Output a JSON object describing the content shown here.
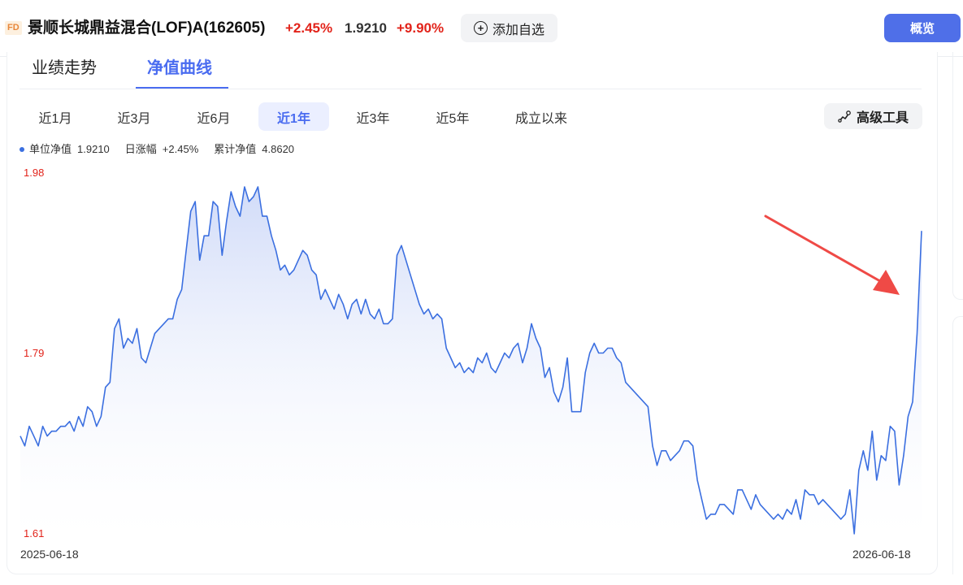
{
  "header": {
    "badge": "FD",
    "fund_name": "景顺长城鼎益混合(LOF)A(162605)",
    "change": "+2.45%",
    "nav": "1.9210",
    "pct": "+9.90%",
    "add_label": "添加自选",
    "overview_label": "概览"
  },
  "tabs": [
    {
      "label": "业绩走势",
      "active": false
    },
    {
      "label": "净值曲线",
      "active": true
    }
  ],
  "ranges": [
    {
      "label": "近1月",
      "active": false
    },
    {
      "label": "近3月",
      "active": false
    },
    {
      "label": "近6月",
      "active": false
    },
    {
      "label": "近1年",
      "active": true
    },
    {
      "label": "近3年",
      "active": false
    },
    {
      "label": "近5年",
      "active": false
    },
    {
      "label": "成立以来",
      "active": false
    }
  ],
  "tools_label": "高级工具",
  "legend": {
    "unit_nav_label": "单位净值",
    "unit_nav_value": "1.9210",
    "daily_label": "日涨幅",
    "daily_value": "+2.45%",
    "cum_label": "累计净值",
    "cum_value": "4.8620"
  },
  "colors": {
    "line": "#3b6fe0",
    "accent": "#4a6cf0",
    "up": "#e2231a",
    "arrow": "#ef4a46"
  },
  "chart_data": {
    "type": "area",
    "series": [
      {
        "values": [
          1.71,
          1.7,
          1.72,
          1.71,
          1.7,
          1.72,
          1.71,
          1.715,
          1.715,
          1.72,
          1.72,
          1.725,
          1.715,
          1.73,
          1.72,
          1.74,
          1.735,
          1.72,
          1.73,
          1.76,
          1.765,
          1.82,
          1.83,
          1.8,
          1.81,
          1.805,
          1.82,
          1.79,
          1.785,
          1.8,
          1.815,
          1.82,
          1.825,
          1.83,
          1.83,
          1.85,
          1.86,
          1.9,
          1.94,
          1.95,
          1.89,
          1.915,
          1.915,
          1.95,
          1.945,
          1.895,
          1.93,
          1.96,
          1.945,
          1.935,
          1.965,
          1.95,
          1.955,
          1.965,
          1.935,
          1.935,
          1.915,
          1.9,
          1.88,
          1.885,
          1.875,
          1.88,
          1.89,
          1.9,
          1.895,
          1.88,
          1.875,
          1.85,
          1.86,
          1.85,
          1.84,
          1.855,
          1.845,
          1.83,
          1.845,
          1.85,
          1.835,
          1.85,
          1.835,
          1.83,
          1.84,
          1.825,
          1.825,
          1.83,
          1.895,
          1.905,
          1.89,
          1.875,
          1.86,
          1.845,
          1.835,
          1.84,
          1.83,
          1.835,
          1.83,
          1.8,
          1.79,
          1.78,
          1.785,
          1.775,
          1.78,
          1.775,
          1.79,
          1.785,
          1.795,
          1.78,
          1.775,
          1.785,
          1.795,
          1.79,
          1.8,
          1.805,
          1.785,
          1.8,
          1.825,
          1.81,
          1.8,
          1.77,
          1.78,
          1.755,
          1.745,
          1.76,
          1.79,
          1.735,
          1.735,
          1.735,
          1.775,
          1.795,
          1.805,
          1.795,
          1.795,
          1.8,
          1.8,
          1.79,
          1.785,
          1.765,
          1.76,
          1.755,
          1.75,
          1.745,
          1.74,
          1.7,
          1.68,
          1.695,
          1.695,
          1.685,
          1.69,
          1.695,
          1.705,
          1.705,
          1.7,
          1.665,
          1.645,
          1.625,
          1.63,
          1.63,
          1.64,
          1.64,
          1.635,
          1.63,
          1.655,
          1.655,
          1.645,
          1.635,
          1.65,
          1.64,
          1.635,
          1.63,
          1.625,
          1.63,
          1.625,
          1.635,
          1.63,
          1.645,
          1.625,
          1.655,
          1.65,
          1.65,
          1.64,
          1.645,
          1.64,
          1.635,
          1.63,
          1.625,
          1.63,
          1.655,
          1.61,
          1.675,
          1.695,
          1.675,
          1.715,
          1.665,
          1.69,
          1.685,
          1.72,
          1.715,
          1.66,
          1.69,
          1.73,
          1.745,
          1.815,
          1.92
        ],
        "last": 1.921
      }
    ],
    "x_start": "2025-06-18",
    "x_end": "2026-06-18",
    "y_ticks": [
      "1.98",
      "1.79",
      "1.61"
    ],
    "ylim": [
      1.61,
      1.98
    ],
    "grid": false
  }
}
